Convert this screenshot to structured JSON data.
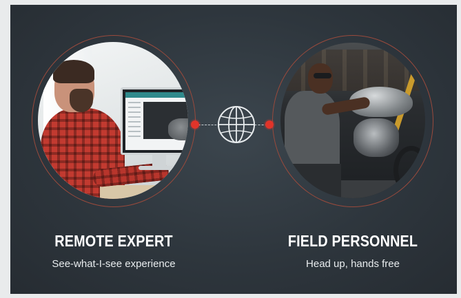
{
  "panels": {
    "left": {
      "title": "REMOTE EXPERT",
      "subtitle": "See-what-I-see experience"
    },
    "right": {
      "title": "FIELD PERSONNEL",
      "subtitle": "Head up, hands free"
    }
  },
  "connector": {
    "icon": "globe-icon",
    "dot_color": "#e0342a",
    "line_color": "#c9cfd3"
  },
  "colors": {
    "background": "#2e363d",
    "ring": "#9a4a3c",
    "text": "#ffffff"
  }
}
